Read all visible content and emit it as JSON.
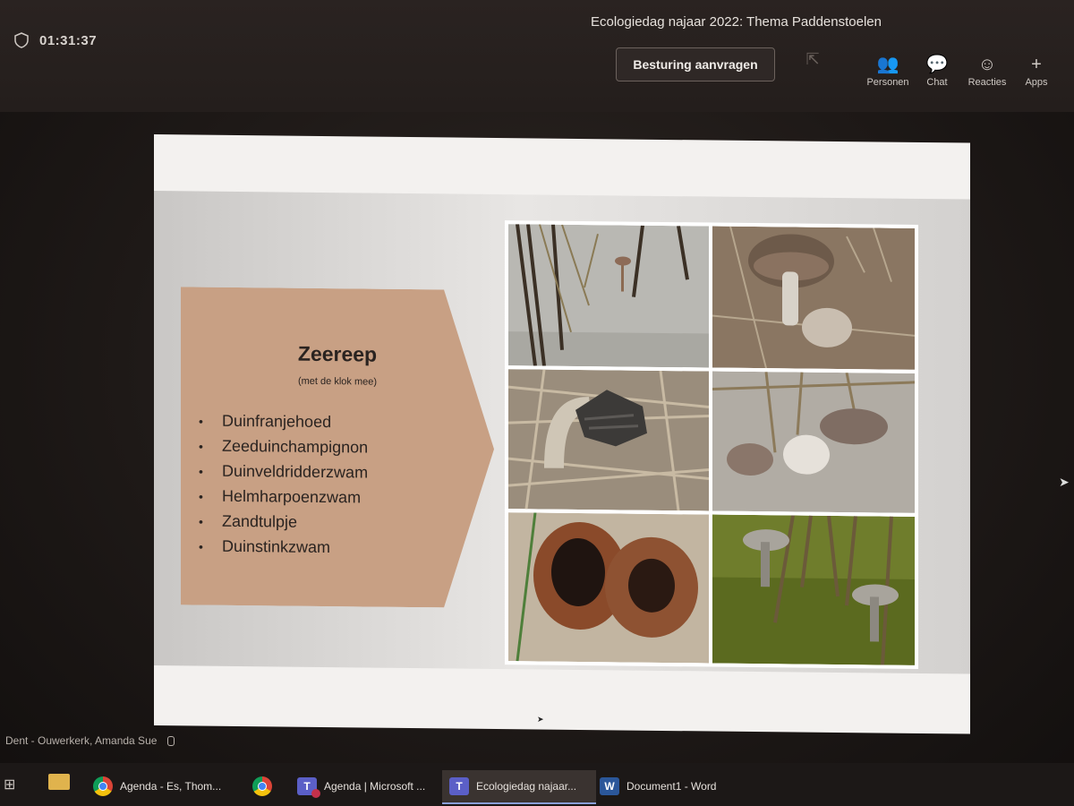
{
  "meeting": {
    "timer": "01:31:37",
    "title": "Ecologiedag najaar 2022: Thema Paddenstoelen",
    "request_control_label": "Besturing aanvragen",
    "toolbar": [
      {
        "label": "Personen",
        "icon": "people-icon"
      },
      {
        "label": "Chat",
        "icon": "chat-icon"
      },
      {
        "label": "Reacties",
        "icon": "reactions-icon"
      },
      {
        "label": "Apps",
        "icon": "plus-icon"
      }
    ]
  },
  "slide": {
    "title": "Zeereep",
    "subtitle": "(met de klok mee)",
    "species": [
      "Duinfranjehoed",
      "Zeeduinchampignon",
      "Duinveldridderzwam",
      "Helmharpoenzwam",
      "Zandtulpje",
      "Duinstinkzwam"
    ],
    "accent_color": "#c8a084"
  },
  "presenter": {
    "name": "Dent - Ouwerkerk, Amanda Sue"
  },
  "taskbar": {
    "items": [
      {
        "label": "Agenda - Es, Thom...",
        "icon": "chrome-icon"
      },
      {
        "label": "",
        "icon": "chrome-icon"
      },
      {
        "label": "Agenda | Microsoft ...",
        "icon": "teams-icon"
      },
      {
        "label": "Ecologiedag najaar...",
        "icon": "teams-icon"
      },
      {
        "label": "Document1 - Word",
        "icon": "word-icon"
      }
    ]
  }
}
